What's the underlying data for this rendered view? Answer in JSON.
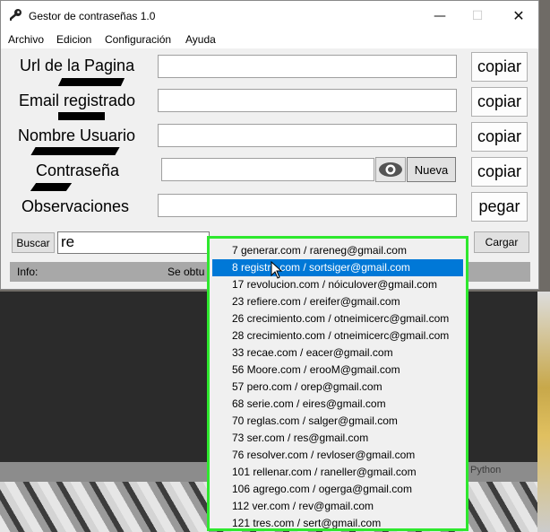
{
  "window": {
    "title": "Gestor de contraseñas 1.0",
    "min": "—",
    "max": "☐",
    "close": "✕"
  },
  "menu": [
    "Archivo",
    "Edicion",
    "Configuración",
    "Ayuda"
  ],
  "fields": [
    {
      "label": "Url de la Pagina",
      "value": "",
      "button": "copiar"
    },
    {
      "label": "Email registrado",
      "value": "",
      "button": "copiar"
    },
    {
      "label": "Nombre Usuario",
      "value": "",
      "button": "copiar"
    },
    {
      "label": "Contraseña",
      "value": "",
      "button": "copiar"
    },
    {
      "label": "Observaciones",
      "value": "",
      "button": "pegar"
    }
  ],
  "password_actions": {
    "toggle_icon": "eye-icon",
    "generate_label": "Nueva"
  },
  "search": {
    "button_label": "Buscar",
    "value": "re",
    "load_label": "Cargar"
  },
  "info": {
    "label": "Info:",
    "status": "Se obtu"
  },
  "background_text": "Python",
  "dropdown": {
    "selected_index": 1,
    "items": [
      "7 generar.com / rareneg@gmail.com",
      "8 registro.com / sortsiger@gmail.com",
      "17 revolucion.com / nóiculover@gmail.com",
      "23 refiere.com / ereifer@gmail.com",
      "26 crecimiento.com / otneimicerc@gmail.com",
      "28 crecimiento.com / otneimicerc@gmail.com",
      "33 recae.com / eacer@gmail.com",
      "56 Moore.com / erooM@gmail.com",
      "57 pero.com / orep@gmail.com",
      "68 serie.com / eires@gmail.com",
      "70 reglas.com / salger@gmail.com",
      "73 ser.com / res@gmail.com",
      "76 resolver.com / revloser@gmail.com",
      "101 rellenar.com / raneller@gmail.com",
      "106 agrego.com / ogerga@gmail.com",
      "112 ver.com / rev@gmail.com",
      "121 tres.com / sert@gmail.com"
    ]
  },
  "colors": {
    "highlight": "#0078d7",
    "dropdown_border": "#2ee82e",
    "info_bar": "#a8a8a8"
  }
}
